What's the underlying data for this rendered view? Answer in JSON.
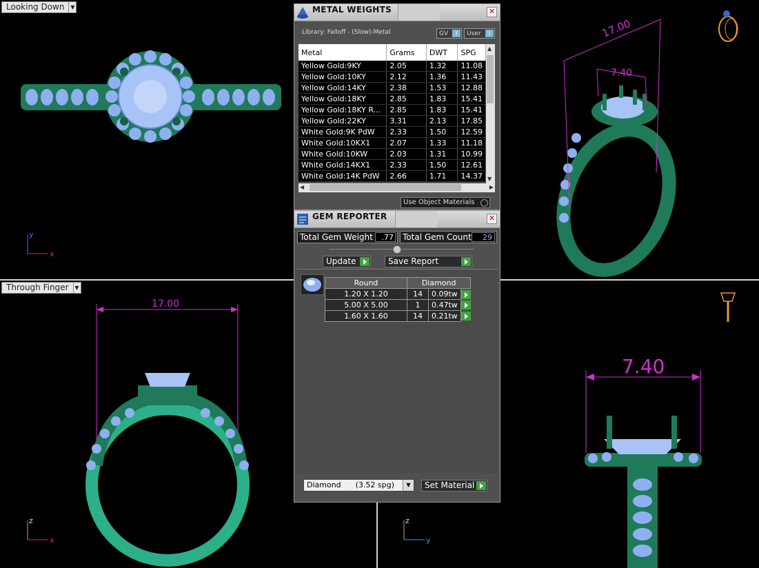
{
  "viewports": {
    "top_left": {
      "label": "Looking Down",
      "axis_v": "y",
      "axis_h": "x"
    },
    "top_right": {
      "dim_outer": "17.00",
      "dim_inner": "7.40"
    },
    "bottom_left": {
      "label": "Through Finger",
      "dimension": "17.00",
      "axis_v": "z",
      "axis_h": "x"
    },
    "bottom_right": {
      "dimension": "7.40",
      "axis_v": "z",
      "axis_h": "y"
    }
  },
  "metal_weights": {
    "title": "METAL WEIGHTS",
    "library": "Library: Falloff - (Slow)-Metal",
    "toggle_gv": "GV",
    "toggle_user": "User",
    "toggle_knob": "I",
    "columns": [
      "Metal",
      "Grams",
      "DWT",
      "SPG"
    ],
    "rows": [
      [
        "Yellow Gold:9KY",
        "2.05",
        "1.32",
        "11.08"
      ],
      [
        "Yellow Gold:10KY",
        "2.12",
        "1.36",
        "11.43"
      ],
      [
        "Yellow Gold:14KY",
        "2.38",
        "1.53",
        "12.88"
      ],
      [
        "Yellow Gold:18KY",
        "2.85",
        "1.83",
        "15.41"
      ],
      [
        "Yellow Gold:18KY R...",
        "2.85",
        "1.83",
        "15.41"
      ],
      [
        "Yellow Gold:22KY",
        "3.31",
        "2.13",
        "17.85"
      ],
      [
        "White Gold:9K PdW",
        "2.33",
        "1.50",
        "12.59"
      ],
      [
        "White Gold:10KX1",
        "2.07",
        "1.33",
        "11.18"
      ],
      [
        "White Gold:10KW",
        "2.03",
        "1.31",
        "10.99"
      ],
      [
        "White Gold:14KX1",
        "2.33",
        "1.50",
        "12.61"
      ],
      [
        "White Gold:14K PdW",
        "2.66",
        "1.71",
        "14.37"
      ]
    ],
    "use_object_materials": "Use Object Materials"
  },
  "gem_reporter": {
    "title": "GEM REPORTER",
    "total_weight_label": "Total Gem Weight",
    "total_weight_value": ".77",
    "total_count_label": "Total Gem Count",
    "total_count_value": "29",
    "update_label": "Update",
    "save_report_label": "Save Report",
    "shape_header": "Round",
    "material_header": "Diamond",
    "gems": [
      {
        "size": "1.20 X 1.20",
        "count": "14",
        "weight": "0.09tw"
      },
      {
        "size": "5.00 X 5.00",
        "count": "1",
        "weight": "0.47tw"
      },
      {
        "size": "1.60 X 1.60",
        "count": "14",
        "weight": "0.21tw"
      }
    ],
    "material_select": "Diamond      (3.52 spg)",
    "set_material_label": "Set Material"
  },
  "colors": {
    "metal": "#1f7a5a",
    "gem": "#8fb0f0",
    "dimension": "#d030d0",
    "panel": "#505050"
  }
}
